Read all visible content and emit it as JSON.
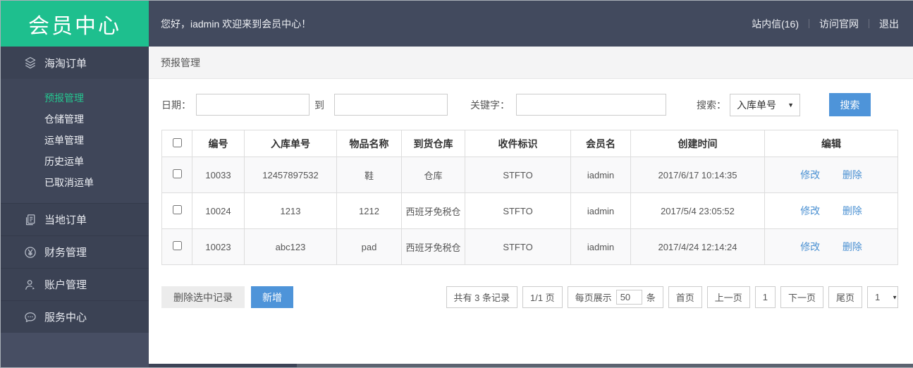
{
  "brand": {
    "title": "会员中心"
  },
  "topbar": {
    "welcome": "您好，iadmin  欢迎来到会员中心！",
    "links": [
      {
        "label": "站内信(16)"
      },
      {
        "label": "访问官网"
      },
      {
        "label": "退出"
      }
    ]
  },
  "sidebar": {
    "sections": [
      {
        "label": "海淘订单",
        "icon": "layers-icon",
        "active": true,
        "children": [
          {
            "label": "预报管理",
            "active": true
          },
          {
            "label": "仓储管理"
          },
          {
            "label": "运单管理"
          },
          {
            "label": "历史运单"
          },
          {
            "label": "已取消运单"
          }
        ]
      },
      {
        "label": "当地订单",
        "icon": "document-icon"
      },
      {
        "label": "财务管理",
        "icon": "yen-circle-icon"
      },
      {
        "label": "账户管理",
        "icon": "user-icon"
      },
      {
        "label": "服务中心",
        "icon": "chat-bubble-icon"
      }
    ]
  },
  "breadcrumb": {
    "title": "预报管理"
  },
  "filters": {
    "date_label": "日期：",
    "date_from_value": "",
    "to_label": "到",
    "date_to_value": "",
    "keyword_label": "关键字：",
    "keyword_value": "",
    "search_label": "搜索：",
    "search_type_selected": "入库单号",
    "search_button": "搜索"
  },
  "table": {
    "columns": [
      "编号",
      "入库单号",
      "物品名称",
      "到货仓库",
      "收件标识",
      "会员名",
      "创建时间",
      "编辑"
    ],
    "rows": [
      {
        "id": "10033",
        "storage_no": "12457897532",
        "item": "鞋",
        "warehouse": "仓库",
        "receiver_tag": "STFTO",
        "member": "iadmin",
        "created": "2017/6/17 10:14:35"
      },
      {
        "id": "10024",
        "storage_no": "1213",
        "item": "1212",
        "warehouse": "西班牙免税仓",
        "receiver_tag": "STFTO",
        "member": "iadmin",
        "created": "2017/5/4 23:05:52"
      },
      {
        "id": "10023",
        "storage_no": "abc123",
        "item": "pad",
        "warehouse": "西班牙免税仓",
        "receiver_tag": "STFTO",
        "member": "iadmin",
        "created": "2017/4/24 12:14:24"
      }
    ],
    "row_actions": {
      "edit": "修改",
      "delete": "删除"
    }
  },
  "actions": {
    "delete_selected": "删除选中记录",
    "add_new": "新增"
  },
  "pagination": {
    "total": "共有 3 条记录",
    "page_info": "1/1 页",
    "per_page_prefix": "每页展示",
    "per_page_value": "50",
    "per_page_suffix": "条",
    "first": "首页",
    "prev": "上一页",
    "current": "1",
    "next": "下一页",
    "last": "尾页",
    "page_select_value": "1"
  },
  "colors": {
    "brand_green": "#1ebf8e",
    "topbar_navy": "#424a5e",
    "sidebar_navy": "#3b4254",
    "link_blue": "#4a90d2",
    "button_blue": "#4e94d9"
  }
}
